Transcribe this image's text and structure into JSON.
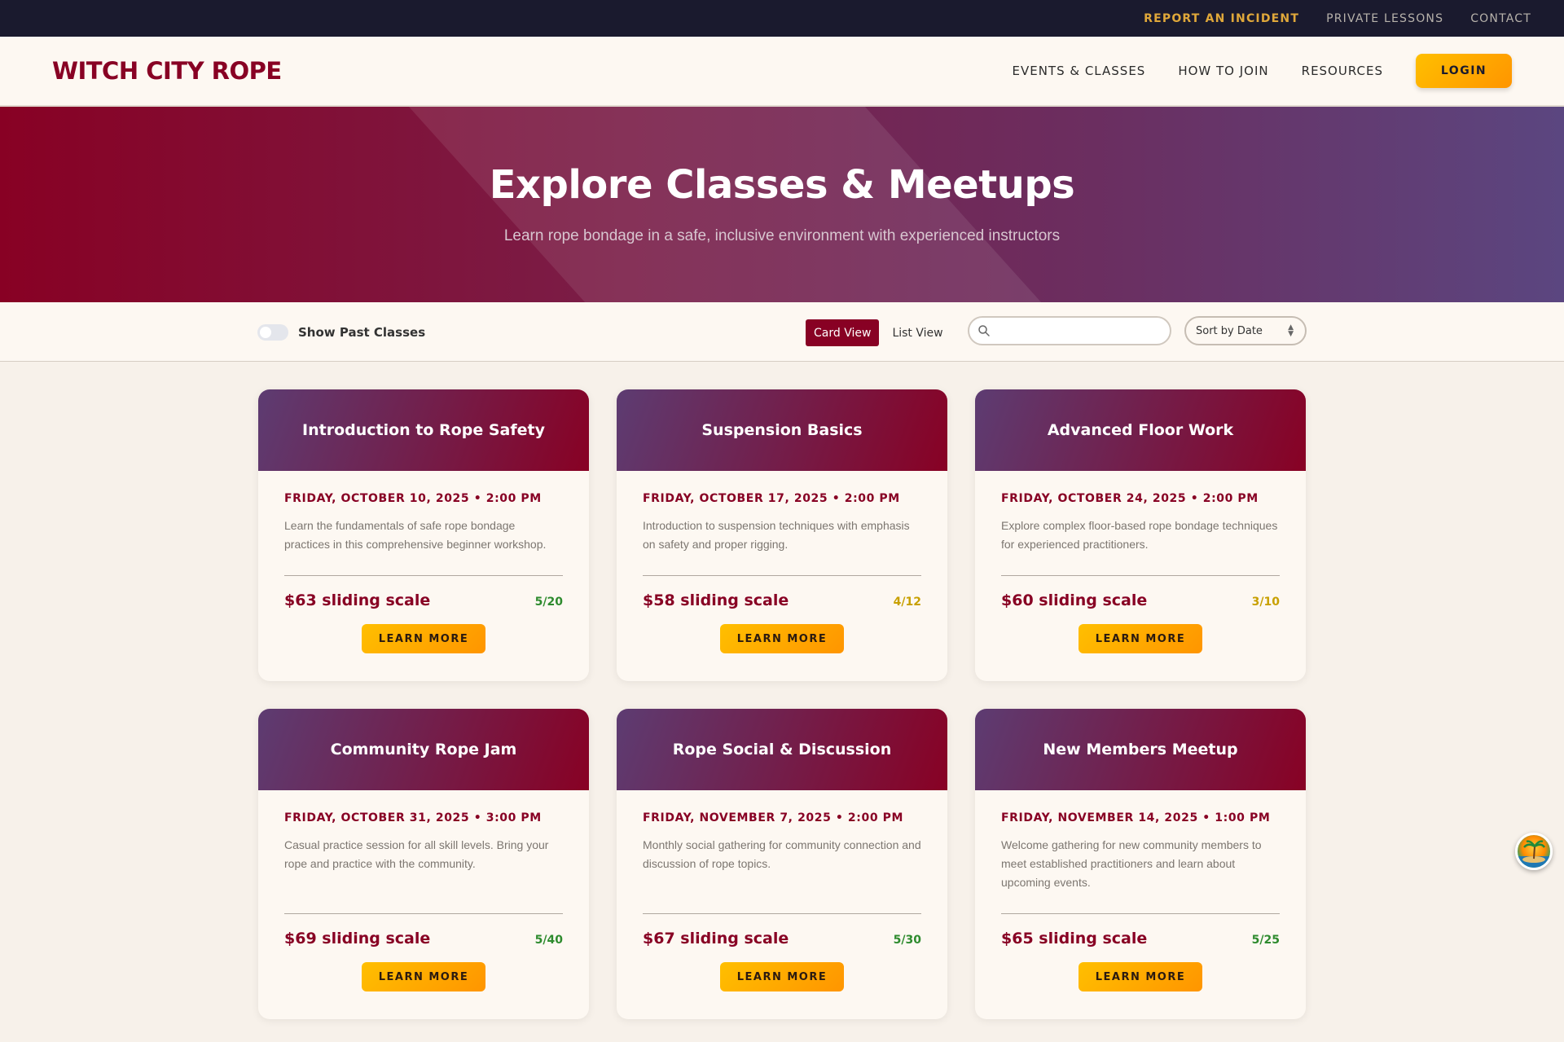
{
  "utility_nav": [
    {
      "label": "REPORT AN INCIDENT"
    },
    {
      "label": "PRIVATE LESSONS"
    },
    {
      "label": "CONTACT"
    }
  ],
  "header": {
    "logo": "WITCH CITY ROPE",
    "nav": [
      {
        "label": "EVENTS & CLASSES"
      },
      {
        "label": "HOW TO JOIN"
      },
      {
        "label": "RESOURCES"
      }
    ],
    "login_label": "LOGIN"
  },
  "hero": {
    "title": "Explore Classes & Meetups",
    "subtitle": "Learn rope bondage in a safe, inclusive environment with experienced instructors"
  },
  "filters": {
    "past_toggle_label": "Show Past Classes",
    "past_toggle_on": false,
    "views": [
      {
        "label": "Card View",
        "active": true
      },
      {
        "label": "List View",
        "active": false
      }
    ],
    "search_value": "",
    "sort_label": "Sort by Date"
  },
  "colors": {
    "brand": "#880124",
    "accent": "#ffbf00",
    "cap_available": "#2e8b2e",
    "cap_limited": "#c8a000"
  },
  "events": [
    {
      "title": "Introduction to Rope Safety",
      "date": "FRIDAY, OCTOBER 10, 2025 • 2:00 PM",
      "description": "Learn the fundamentals of safe rope bondage practices in this comprehensive beginner workshop.",
      "price": "$63 sliding scale",
      "capacity": "5/20",
      "capacity_color": "#2e8b2e",
      "button": "LEARN MORE"
    },
    {
      "title": "Suspension Basics",
      "date": "FRIDAY, OCTOBER 17, 2025 • 2:00 PM",
      "description": "Introduction to suspension techniques with emphasis on safety and proper rigging.",
      "price": "$58 sliding scale",
      "capacity": "4/12",
      "capacity_color": "#c8a000",
      "button": "LEARN MORE"
    },
    {
      "title": "Advanced Floor Work",
      "date": "FRIDAY, OCTOBER 24, 2025 • 2:00 PM",
      "description": "Explore complex floor-based rope bondage techniques for experienced practitioners.",
      "price": "$60 sliding scale",
      "capacity": "3/10",
      "capacity_color": "#c8a000",
      "button": "LEARN MORE"
    },
    {
      "title": "Community Rope Jam",
      "date": "FRIDAY, OCTOBER 31, 2025 • 3:00 PM",
      "description": "Casual practice session for all skill levels. Bring your rope and practice with the community.",
      "price": "$69 sliding scale",
      "capacity": "5/40",
      "capacity_color": "#2e8b2e",
      "button": "LEARN MORE"
    },
    {
      "title": "Rope Social & Discussion",
      "date": "FRIDAY, NOVEMBER 7, 2025 • 2:00 PM",
      "description": "Monthly social gathering for community connection and discussion of rope topics.",
      "price": "$67 sliding scale",
      "capacity": "5/30",
      "capacity_color": "#2e8b2e",
      "button": "LEARN MORE"
    },
    {
      "title": "New Members Meetup",
      "date": "FRIDAY, NOVEMBER 14, 2025 • 1:00 PM",
      "description": "Welcome gathering for new community members to meet established practitioners and learn about upcoming events.",
      "price": "$65 sliding scale",
      "capacity": "5/25",
      "capacity_color": "#2e8b2e",
      "button": "LEARN MORE"
    }
  ],
  "icons": {
    "search": "search-icon",
    "sort": "chevron-updown-icon",
    "avatar": "avatar"
  }
}
